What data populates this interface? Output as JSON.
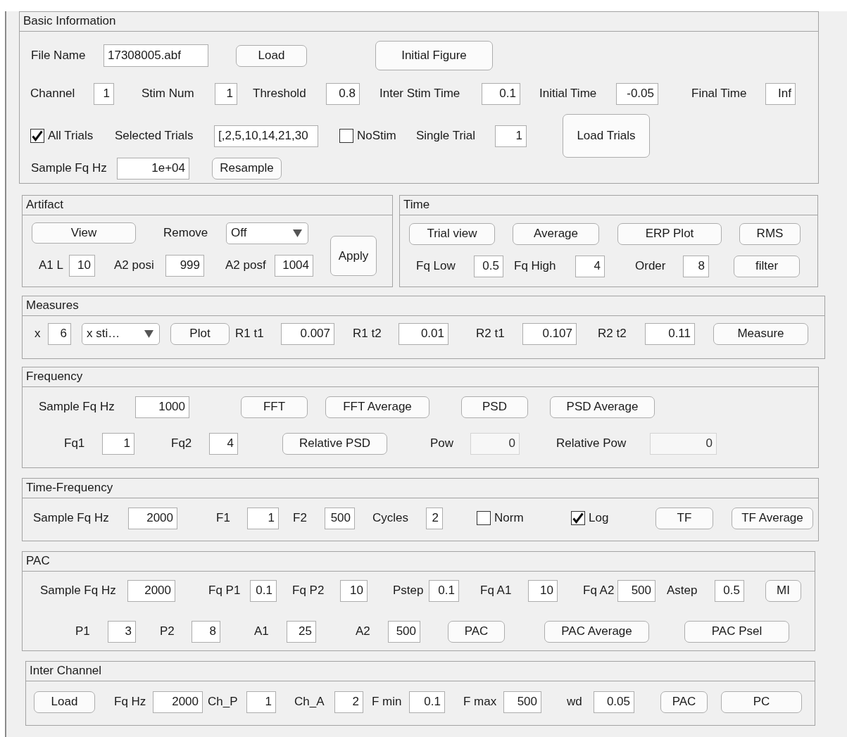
{
  "panels": [
    {
      "title": "Basic Information",
      "lines": [
        {
          "controls": [
            {
              "kind": "label",
              "text": "File Name"
            },
            {
              "kind": "text_field",
              "value": "17308005.abf",
              "disabled": false
            },
            {
              "kind": "button",
              "label": "Load"
            },
            {
              "kind": "button",
              "label": "Initial Figure"
            }
          ]
        },
        {
          "controls": [
            {
              "kind": "label",
              "text": "Channel"
            },
            {
              "kind": "field",
              "value": "1",
              "disabled": false
            },
            {
              "kind": "label",
              "text": "Stim Num"
            },
            {
              "kind": "field",
              "value": "1",
              "disabled": false
            },
            {
              "kind": "label",
              "text": "Threshold"
            },
            {
              "kind": "field",
              "value": "0.8",
              "disabled": false
            },
            {
              "kind": "label",
              "text": "Inter Stim Time"
            },
            {
              "kind": "field",
              "value": "0.1",
              "disabled": false
            },
            {
              "kind": "label",
              "text": "Initial Time"
            },
            {
              "kind": "field",
              "value": "-0.05",
              "disabled": false
            },
            {
              "kind": "label",
              "text": "Final Time"
            },
            {
              "kind": "field",
              "value": "Inf",
              "disabled": false
            }
          ]
        },
        {
          "controls": [
            {
              "kind": "checkbox",
              "label": "All Trials",
              "checked": true
            },
            {
              "kind": "label",
              "text": "Selected Trials"
            },
            {
              "kind": "text_field",
              "value": "[,2,5,10,14,21,30",
              "disabled": false
            },
            {
              "kind": "checkbox",
              "label": "NoStim",
              "checked": false
            },
            {
              "kind": "label",
              "text": "Single Trial"
            },
            {
              "kind": "field",
              "value": "1",
              "disabled": false
            },
            {
              "kind": "button",
              "label": "Load Trials"
            }
          ]
        },
        {
          "controls": [
            {
              "kind": "label",
              "text": "Sample Fq Hz"
            },
            {
              "kind": "field",
              "value": "1e+04",
              "disabled": false
            },
            {
              "kind": "button",
              "label": "Resample"
            }
          ]
        }
      ]
    },
    {
      "title": "Artifact",
      "lines": [
        {
          "controls": [
            {
              "kind": "button",
              "label": "View"
            },
            {
              "kind": "label",
              "text": "Remove"
            },
            {
              "kind": "dropdown",
              "value": "Off"
            }
          ]
        },
        {
          "controls": [
            {
              "kind": "label",
              "text": "A1 L"
            },
            {
              "kind": "field",
              "value": "10",
              "disabled": false
            },
            {
              "kind": "label",
              "text": "A2 posi"
            },
            {
              "kind": "field",
              "value": "999",
              "disabled": false
            },
            {
              "kind": "label",
              "text": "A2 posf"
            },
            {
              "kind": "field",
              "value": "1004",
              "disabled": false
            },
            {
              "kind": "button",
              "label": "Apply"
            }
          ]
        }
      ]
    },
    {
      "title": "Time",
      "lines": [
        {
          "controls": [
            {
              "kind": "button",
              "label": "Trial view"
            },
            {
              "kind": "button",
              "label": "Average"
            },
            {
              "kind": "button",
              "label": "ERP Plot"
            },
            {
              "kind": "button",
              "label": "RMS"
            }
          ]
        },
        {
          "controls": [
            {
              "kind": "label",
              "text": "Fq Low"
            },
            {
              "kind": "field",
              "value": "0.5",
              "disabled": false
            },
            {
              "kind": "label",
              "text": "Fq High"
            },
            {
              "kind": "field",
              "value": "4",
              "disabled": false
            },
            {
              "kind": "label",
              "text": "Order"
            },
            {
              "kind": "field",
              "value": "8",
              "disabled": false
            },
            {
              "kind": "button",
              "label": "filter"
            }
          ]
        }
      ]
    },
    {
      "title": "Measures",
      "lines": [
        {
          "controls": [
            {
              "kind": "label",
              "text": "x"
            },
            {
              "kind": "field",
              "value": "6",
              "disabled": false
            },
            {
              "kind": "dropdown",
              "value": "x sti…"
            },
            {
              "kind": "button",
              "label": "Plot"
            },
            {
              "kind": "label",
              "text": "R1 t1"
            },
            {
              "kind": "field",
              "value": "0.007",
              "disabled": false
            },
            {
              "kind": "label",
              "text": "R1 t2"
            },
            {
              "kind": "field",
              "value": "0.01",
              "disabled": false
            },
            {
              "kind": "label",
              "text": "R2 t1"
            },
            {
              "kind": "field",
              "value": "0.107",
              "disabled": false
            },
            {
              "kind": "label",
              "text": "R2 t2"
            },
            {
              "kind": "field",
              "value": "0.11",
              "disabled": false
            },
            {
              "kind": "button",
              "label": "Measure"
            }
          ]
        }
      ]
    },
    {
      "title": "Frequency",
      "lines": [
        {
          "controls": [
            {
              "kind": "label",
              "text": "Sample Fq Hz"
            },
            {
              "kind": "field",
              "value": "1000",
              "disabled": false
            },
            {
              "kind": "button",
              "label": "FFT"
            },
            {
              "kind": "button",
              "label": "FFT Average"
            },
            {
              "kind": "button",
              "label": "PSD"
            },
            {
              "kind": "button",
              "label": "PSD Average"
            }
          ]
        },
        {
          "controls": [
            {
              "kind": "label",
              "text": "Fq1"
            },
            {
              "kind": "field",
              "value": "1",
              "disabled": false
            },
            {
              "kind": "label",
              "text": "Fq2"
            },
            {
              "kind": "field",
              "value": "4",
              "disabled": false
            },
            {
              "kind": "button",
              "label": "Relative PSD"
            },
            {
              "kind": "label",
              "text": "Pow"
            },
            {
              "kind": "field",
              "value": "0",
              "disabled": true
            },
            {
              "kind": "label",
              "text": "Relative Pow"
            },
            {
              "kind": "field",
              "value": "0",
              "disabled": true
            }
          ]
        }
      ]
    },
    {
      "title": "Time-Frequency",
      "lines": [
        {
          "controls": [
            {
              "kind": "label",
              "text": "Sample Fq Hz"
            },
            {
              "kind": "field",
              "value": "2000",
              "disabled": false
            },
            {
              "kind": "label",
              "text": "F1"
            },
            {
              "kind": "field",
              "value": "1",
              "disabled": false
            },
            {
              "kind": "label",
              "text": "F2"
            },
            {
              "kind": "field",
              "value": "500",
              "disabled": false
            },
            {
              "kind": "label",
              "text": "Cycles"
            },
            {
              "kind": "field",
              "value": "2",
              "disabled": false
            },
            {
              "kind": "checkbox",
              "label": "Norm",
              "checked": false
            },
            {
              "kind": "checkbox",
              "label": "Log",
              "checked": true
            },
            {
              "kind": "button",
              "label": "TF"
            },
            {
              "kind": "button",
              "label": "TF Average"
            }
          ]
        }
      ]
    },
    {
      "title": "PAC",
      "lines": [
        {
          "controls": [
            {
              "kind": "label",
              "text": "Sample Fq Hz"
            },
            {
              "kind": "field",
              "value": "2000",
              "disabled": false
            },
            {
              "kind": "label",
              "text": "Fq P1"
            },
            {
              "kind": "field",
              "value": "0.1",
              "disabled": false
            },
            {
              "kind": "label",
              "text": "Fq P2"
            },
            {
              "kind": "field",
              "value": "10",
              "disabled": false
            },
            {
              "kind": "label",
              "text": "Pstep"
            },
            {
              "kind": "field",
              "value": "0.1",
              "disabled": false
            },
            {
              "kind": "label",
              "text": "Fq A1"
            },
            {
              "kind": "field",
              "value": "10",
              "disabled": false
            },
            {
              "kind": "label",
              "text": "Fq A2"
            },
            {
              "kind": "field",
              "value": "500",
              "disabled": false
            },
            {
              "kind": "label",
              "text": "Astep"
            },
            {
              "kind": "field",
              "value": "0.5",
              "disabled": false
            },
            {
              "kind": "button",
              "label": "MI"
            }
          ]
        },
        {
          "controls": [
            {
              "kind": "label",
              "text": "P1"
            },
            {
              "kind": "field",
              "value": "3",
              "disabled": false
            },
            {
              "kind": "label",
              "text": "P2"
            },
            {
              "kind": "field",
              "value": "8",
              "disabled": false
            },
            {
              "kind": "label",
              "text": "A1"
            },
            {
              "kind": "field",
              "value": "25",
              "disabled": false
            },
            {
              "kind": "label",
              "text": "A2"
            },
            {
              "kind": "field",
              "value": "500",
              "disabled": false
            },
            {
              "kind": "button",
              "label": "PAC"
            },
            {
              "kind": "button",
              "label": "PAC Average"
            },
            {
              "kind": "button",
              "label": "PAC Psel"
            }
          ]
        }
      ]
    },
    {
      "title": "Inter Channel",
      "lines": [
        {
          "controls": [
            {
              "kind": "button",
              "label": "Load"
            },
            {
              "kind": "label",
              "text": "Fq Hz"
            },
            {
              "kind": "field",
              "value": "2000",
              "disabled": false
            },
            {
              "kind": "label",
              "text": "Ch_P"
            },
            {
              "kind": "field",
              "value": "1",
              "disabled": false
            },
            {
              "kind": "label",
              "text": "Ch_A"
            },
            {
              "kind": "field",
              "value": "2",
              "disabled": false
            },
            {
              "kind": "label",
              "text": "F min"
            },
            {
              "kind": "field",
              "value": "0.1",
              "disabled": false
            },
            {
              "kind": "label",
              "text": "F max"
            },
            {
              "kind": "field",
              "value": "500",
              "disabled": false
            },
            {
              "kind": "label",
              "text": "wd"
            },
            {
              "kind": "field",
              "value": "0.05",
              "disabled": false
            },
            {
              "kind": "button",
              "label": "PAC"
            },
            {
              "kind": "button",
              "label": "PC"
            }
          ]
        }
      ]
    }
  ]
}
